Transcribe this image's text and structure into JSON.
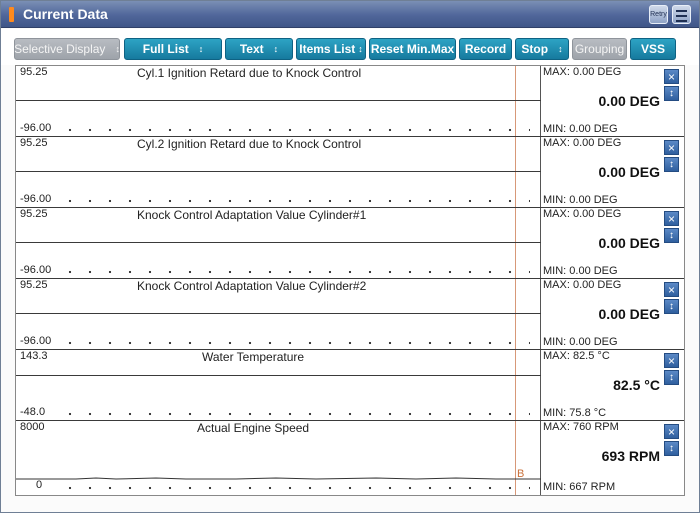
{
  "window": {
    "title": "Current Data",
    "retry_label": "Retry"
  },
  "toolbar": {
    "buttons": [
      {
        "label": "Selective Display",
        "arrow": "↕",
        "disabled": true
      },
      {
        "label": "Full List",
        "arrow": "↕",
        "disabled": false
      },
      {
        "label": "Text",
        "arrow": "↕",
        "disabled": false
      },
      {
        "label": "Items List",
        "arrow": "↕",
        "disabled": false
      },
      {
        "label": "Reset Min.Max",
        "arrow": "",
        "disabled": false
      },
      {
        "label": "Record",
        "arrow": "",
        "disabled": false
      },
      {
        "label": "Stop",
        "arrow": "↕",
        "disabled": false
      },
      {
        "label": "Grouping",
        "arrow": "",
        "disabled": true
      },
      {
        "label": "VSS",
        "arrow": "",
        "disabled": false
      }
    ]
  },
  "graphs": [
    {
      "title": "Cyl.1 Ignition Retard due to Knock Control",
      "axis_max": "95.25",
      "axis_min": "-96.00",
      "max": "MAX:  0.00 DEG",
      "current": "0.00 DEG",
      "min": "MIN:  0.00 DEG"
    },
    {
      "title": "Cyl.2 Ignition Retard due to Knock Control",
      "axis_max": "95.25",
      "axis_min": "-96.00",
      "max": "MAX:  0.00 DEG",
      "current": "0.00 DEG",
      "min": "MIN:  0.00 DEG"
    },
    {
      "title": "Knock Control Adaptation Value Cylinder#1",
      "axis_max": "95.25",
      "axis_min": "-96.00",
      "max": "MAX:  0.00 DEG",
      "current": "0.00 DEG",
      "min": "MIN:  0.00 DEG"
    },
    {
      "title": "Knock Control Adaptation Value Cylinder#2",
      "axis_max": "95.25",
      "axis_min": "-96.00",
      "max": "MAX:  0.00 DEG",
      "current": "0.00 DEG",
      "min": "MIN:  0.00 DEG"
    },
    {
      "title": "Water Temperature",
      "axis_max": "143.3",
      "axis_min": "-48.0",
      "max": "MAX:  82.5 °C",
      "current": "82.5 °C",
      "min": "MIN:  75.8 °C"
    },
    {
      "title": "Actual Engine Speed",
      "axis_max": "8000",
      "axis_min": "0",
      "max": "MAX:    760 RPM",
      "current": "693 RPM",
      "min": "MIN:   667 RPM"
    }
  ],
  "marker": "B",
  "colors": {
    "accent": "#1b8db3",
    "title_bar": "#50669a",
    "marker": "#d79878"
  }
}
